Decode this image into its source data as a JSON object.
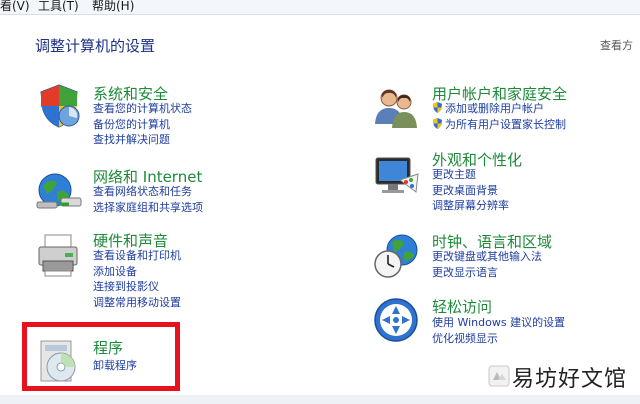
{
  "menu": {
    "view": "看(V)",
    "tools": "工具(T)",
    "help": "帮助(H)"
  },
  "page_title": "调整计算机的设置",
  "view_by": "查看方",
  "categories": {
    "system": {
      "title": "系统和安全",
      "links": [
        "查看您的计算机状态",
        "备份您的计算机",
        "查找并解决问题"
      ]
    },
    "network": {
      "title": "网络和 Internet",
      "links": [
        "查看网络状态和任务",
        "选择家庭组和共享选项"
      ]
    },
    "hardware": {
      "title": "硬件和声音",
      "links": [
        "查看设备和打印机",
        "添加设备",
        "连接到投影仪",
        "调整常用移动设置"
      ]
    },
    "programs": {
      "title": "程序",
      "links": [
        "卸载程序"
      ]
    },
    "users": {
      "title": "用户帐户和家庭安全",
      "links": [
        "添加或删除用户帐户",
        "为所有用户设置家长控制"
      ]
    },
    "appearance": {
      "title": "外观和个性化",
      "links": [
        "更改主题",
        "更改桌面背景",
        "调整屏幕分辨率"
      ]
    },
    "clock": {
      "title": "时钟、语言和区域",
      "links": [
        "更改键盘或其他输入法",
        "更改显示语言"
      ]
    },
    "ease": {
      "title": "轻松访问",
      "links": [
        "使用 Windows 建议的设置",
        "优化视频显示"
      ]
    }
  },
  "watermark": "易坊好文馆",
  "colors": {
    "category_title": "#1d8a3a",
    "link": "#1f3ea0",
    "page_title": "#1e3287",
    "highlight": "#e8121d"
  },
  "icons": [
    "shield-icon",
    "network-globe-icon",
    "printer-icon",
    "programs-disc-icon",
    "users-icon",
    "monitor-palette-icon",
    "clock-globe-icon",
    "accessibility-icon",
    "uac-shield-icon"
  ]
}
